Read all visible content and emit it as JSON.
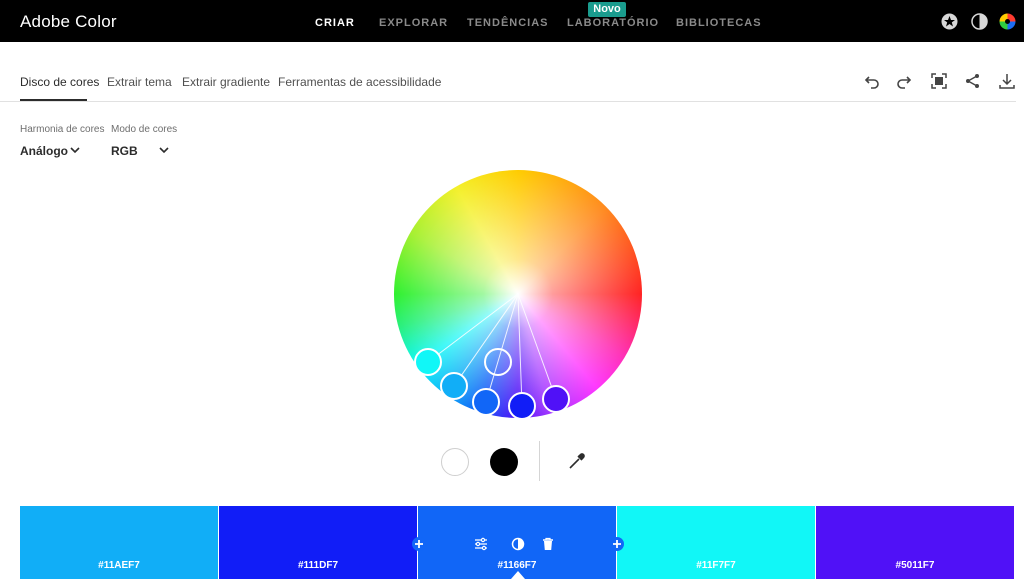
{
  "header": {
    "title": "Adobe Color",
    "nav": [
      {
        "label": "CRIAR",
        "active": true
      },
      {
        "label": "EXPLORAR",
        "active": false
      },
      {
        "label": "TENDÊNCIAS",
        "active": false
      },
      {
        "label": "LABORATÓRIO",
        "active": false
      },
      {
        "label": "BIBLIOTECAS",
        "active": false
      }
    ],
    "badge": "Novo",
    "icons": [
      "star-badge-icon",
      "half-moon-icon",
      "color-wheel-avatar-icon"
    ]
  },
  "tabs": [
    {
      "label": "Disco de cores",
      "active": true
    },
    {
      "label": "Extrair tema",
      "active": false
    },
    {
      "label": "Extrair gradiente",
      "active": false
    },
    {
      "label": "Ferramentas de acessibilidade",
      "active": false
    }
  ],
  "toolbar_icons": [
    "undo-icon",
    "redo-icon",
    "fullscreen-icon",
    "share-icon",
    "download-icon"
  ],
  "controls": {
    "harmony_label": "Harmonia de cores",
    "harmony_value": "Análogo",
    "mode_label": "Modo de cores",
    "mode_value": "RGB"
  },
  "wheel": {
    "markers": [
      "#11F7F7",
      "#11AEF7",
      "#1166F7",
      "#111DF7",
      "#5011F7"
    ],
    "base_marker": "#1166F7",
    "white_marker": "hollow"
  },
  "color_buttons": [
    "white",
    "black"
  ],
  "swatches": [
    {
      "hex": "#11AEF7",
      "color": "#11AEF7"
    },
    {
      "hex": "#111DF7",
      "color": "#111DF7"
    },
    {
      "hex": "#1166F7",
      "color": "#1166F7"
    },
    {
      "hex": "#11F7F7",
      "color": "#11F7F7"
    },
    {
      "hex": "#5011F7",
      "color": "#5011F7"
    }
  ],
  "swatch_tools": [
    "sliders-icon",
    "contrast-icon",
    "trash-icon"
  ]
}
